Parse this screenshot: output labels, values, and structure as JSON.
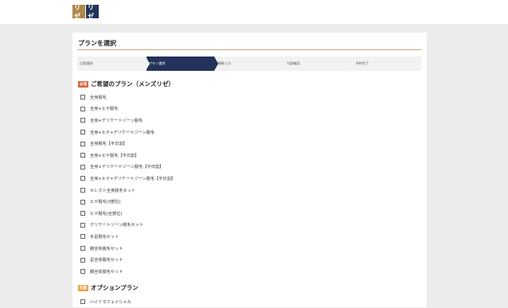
{
  "logo": {
    "left_text": "リゼ",
    "right_text": "リゼ"
  },
  "page": {
    "title": "プランを選択"
  },
  "steps": [
    {
      "label": "日程選択",
      "active": false
    },
    {
      "label": "プラン選択",
      "active": true
    },
    {
      "label": "情報入力",
      "active": false
    },
    {
      "label": "内容確認",
      "active": false
    },
    {
      "label": "予約完了",
      "active": false
    }
  ],
  "plan_section": {
    "badge": "必須",
    "title": "ご希望のプラン（メンズリゼ）"
  },
  "plans": [
    "全身脱毛",
    "全身+ヒゲ脱毛",
    "全身+デリケートゾーン脱毛",
    "全身+ヒゲ+デリケートゾーン脱毛",
    "全身脱毛【平日割】",
    "全身+ヒゲ脱毛【平日割】",
    "全身+デリケートゾーン脱毛【平日割】",
    "全身+ヒゲ+デリケートゾーン脱毛【平日割】",
    "セレクト全身脱毛セット",
    "ヒゲ脱毛(3部位)",
    "ヒゲ脱毛(全部位)",
    "デリケートゾーン脱毛セット",
    "手足脱毛セット",
    "腕全体脱毛セット",
    "足全体脱毛セット",
    "胴全体脱毛セット"
  ],
  "option_section": {
    "badge": "任意",
    "title": "オプションプラン"
  },
  "options": [
    "ハイドラフェイシャル"
  ],
  "colors": {
    "navy": "#22325a",
    "gold": "#b0874d",
    "required": "#d9633b",
    "optional": "#e9a34a"
  }
}
